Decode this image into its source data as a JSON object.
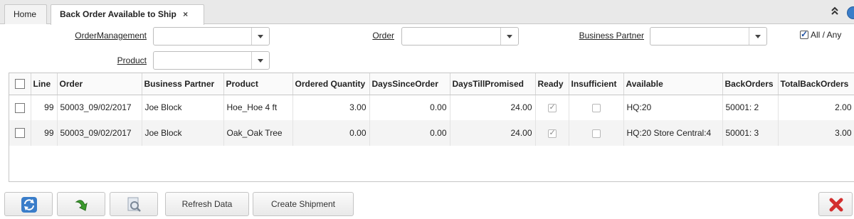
{
  "tabs": {
    "home_label": "Home",
    "active_label": "Back Order Available to Ship",
    "close_glyph": "×"
  },
  "header_icons": {
    "collapse_glyph": "⌃⌃"
  },
  "criteria": {
    "order_management_label": "OrderManagement",
    "order_label": "Order",
    "business_partner_label": "Business Partner",
    "product_label": "Product",
    "order_management_value": "",
    "order_value": "",
    "business_partner_value": "",
    "product_value": "",
    "all_any_label": "All / Any",
    "all_any_checked": true
  },
  "grid": {
    "columns": {
      "line": "Line",
      "order": "Order",
      "business_partner": "Business Partner",
      "product": "Product",
      "ordered_quantity": "Ordered Quantity",
      "days_since_order": "DaysSinceOrder",
      "days_till_promised": "DaysTillPromised",
      "ready": "Ready",
      "insufficient": "Insufficient",
      "available": "Available",
      "back_orders": "BackOrders",
      "total_back_orders": "TotalBackOrders"
    },
    "rows": [
      {
        "line": "99",
        "order": "50003_09/02/2017",
        "business_partner": "Joe Block",
        "product": "Hoe_Hoe 4 ft",
        "ordered_quantity": "3.00",
        "days_since_order": "0.00",
        "days_till_promised": "24.00",
        "ready": true,
        "insufficient": false,
        "available": "HQ:20",
        "back_orders": "50001: 2",
        "total_back_orders": "2.00"
      },
      {
        "line": "99",
        "order": "50003_09/02/2017",
        "business_partner": "Joe Block",
        "product": "Oak_Oak Tree",
        "ordered_quantity": "0.00",
        "days_since_order": "0.00",
        "days_till_promised": "24.00",
        "ready": true,
        "insufficient": false,
        "available": "HQ:20 Store Central:4",
        "back_orders": "50001: 3",
        "total_back_orders": "3.00"
      }
    ]
  },
  "toolbar": {
    "refresh_icon": "refresh-icon",
    "process_icon": "green-arrow-icon",
    "zoom_icon": "zoom-icon",
    "refresh_data_label": "Refresh Data",
    "create_shipment_label": "Create Shipment",
    "cancel_icon": "red-x-icon"
  },
  "colors": {
    "accent_blue": "#3a7dc9",
    "cancel_red": "#d32f2f",
    "process_green": "#3a9a2c"
  }
}
